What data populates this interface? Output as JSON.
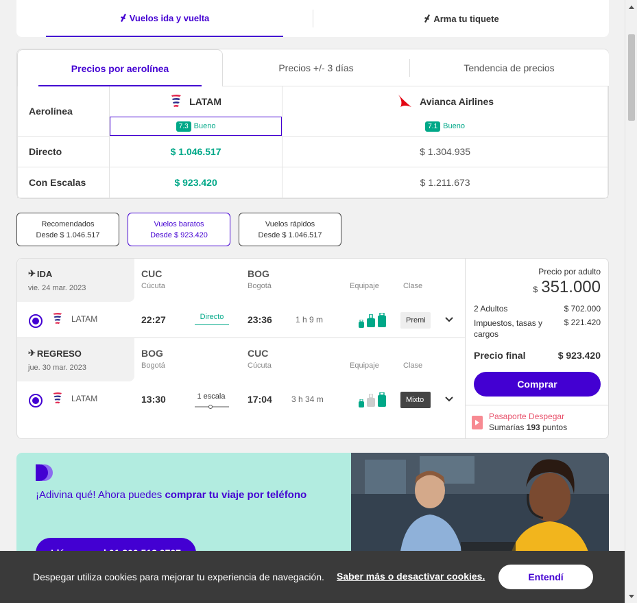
{
  "top_tabs": {
    "tab1": "Vuelos ida y vuelta",
    "tab2": "Arma tu tiquete"
  },
  "price_tabs": [
    "Precios por aerolínea",
    "Precios +/- 3 días",
    "Tendencia de precios"
  ],
  "price_table": {
    "row_labels": {
      "airline": "Aerolínea",
      "direct": "Directo",
      "stops": "Con Escalas"
    },
    "airlines": [
      {
        "name": "LATAM",
        "rating": "7.3",
        "rating_label": "Bueno",
        "direct": "$ 1.046.517",
        "stops": "$ 923.420"
      },
      {
        "name": "Avianca Airlines",
        "rating": "7.1",
        "rating_label": "Bueno",
        "direct": "$ 1.304.935",
        "stops": "$ 1.211.673"
      }
    ]
  },
  "filters": [
    {
      "label": "Recomendados",
      "sub": "Desde $ 1.046.517"
    },
    {
      "label": "Vuelos baratos",
      "sub": "Desde $ 923.420"
    },
    {
      "label": "Vuelos rápidos",
      "sub": "Desde $ 1.046.517"
    }
  ],
  "outbound": {
    "title": "IDA",
    "date": "vie. 24 mar. 2023",
    "from_code": "CUC",
    "from_city": "Cúcuta",
    "to_code": "BOG",
    "to_city": "Bogotá",
    "baggage_header": "Equipaje",
    "class_header": "Clase",
    "airline": "LATAM",
    "dep": "22:27",
    "stops": "Directo",
    "arr": "23:36",
    "duration": "1 h 9 m",
    "class": "Premi"
  },
  "return": {
    "title": "REGRESO",
    "date": "jue. 30 mar. 2023",
    "from_code": "BOG",
    "from_city": "Bogotá",
    "to_code": "CUC",
    "to_city": "Cúcuta",
    "baggage_header": "Equipaje",
    "class_header": "Clase",
    "airline": "LATAM",
    "dep": "13:30",
    "stops": "1 escala",
    "arr": "17:04",
    "duration": "3 h 34 m",
    "class": "Mixto"
  },
  "price_panel": {
    "per_adult_label": "Precio por adulto",
    "currency": "$",
    "per_adult": "351.000",
    "adults_label": "2 Adultos",
    "adults_value": "$ 702.000",
    "taxes_label": "Impuestos, tasas y cargos",
    "taxes_value": "$ 221.420",
    "final_label": "Precio final",
    "final_value": "$ 923.420",
    "buy_label": "Comprar",
    "passport_title": "Pasaporte Despegar",
    "passport_prefix": "Sumarías ",
    "passport_points": "193",
    "passport_suffix": " puntos"
  },
  "promo": {
    "text_a": "¡Adivina qué! Ahora puedes ",
    "text_b": "comprar tu viaje por teléfono",
    "button": "Llámanos al 01 800 518 2727"
  },
  "cookie": {
    "text": "Despegar utiliza cookies para mejorar tu experiencia de navegación.",
    "link": "Saber más o desactivar cookies.",
    "button": "Entendí"
  },
  "colors": {
    "accent": "#4300d2",
    "good": "#00a888",
    "avianca": "#e30613"
  }
}
